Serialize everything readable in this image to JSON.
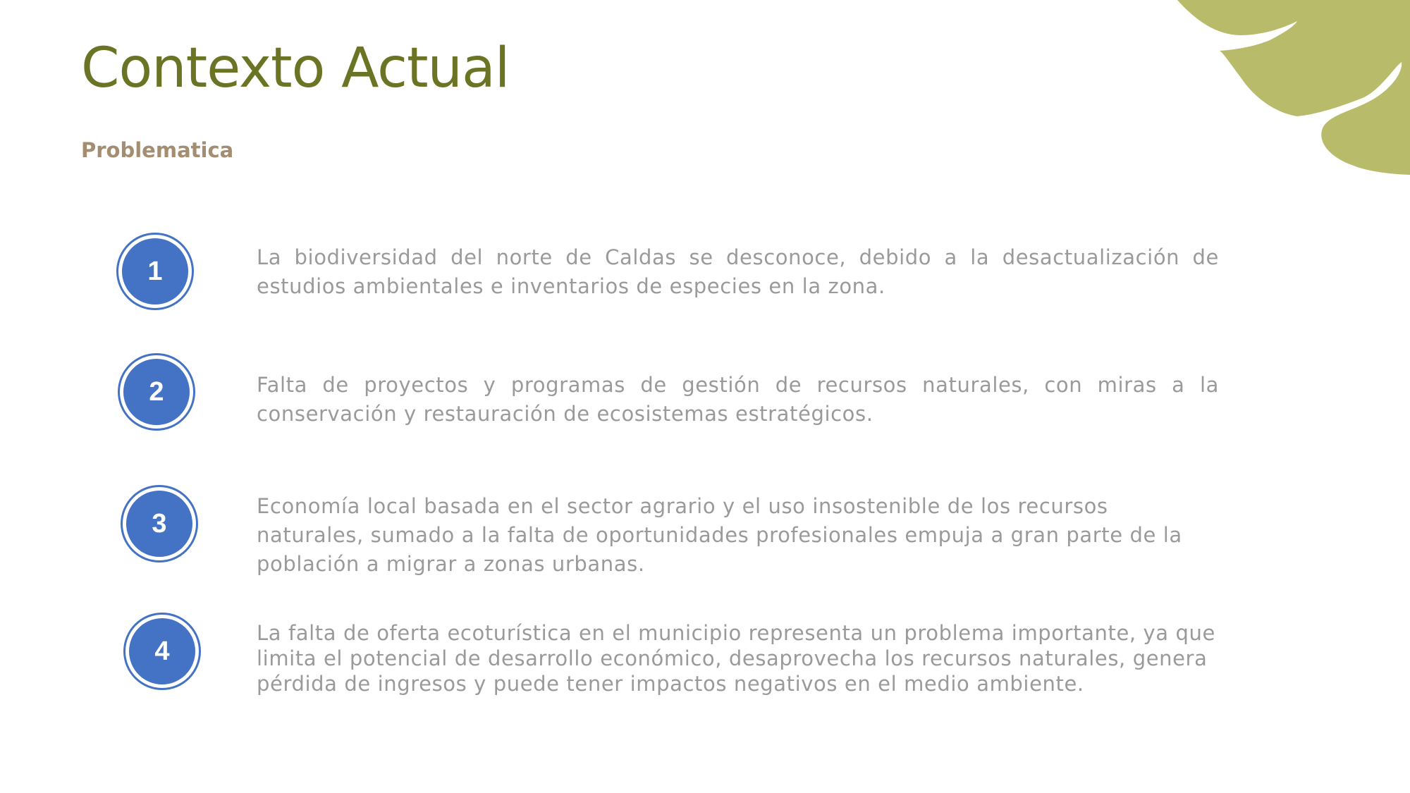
{
  "slide": {
    "title": "Contexto Actual",
    "subtitle": "Problematica",
    "accent_color": "#6b7424",
    "subtitle_color": "#a48d70",
    "leaf_color": "#b8bc6a",
    "badge_color": "#4472c4",
    "items": [
      {
        "number": "1",
        "text": "La biodiversidad del norte de Caldas se desconoce, debido a la desactualización de estudios ambientales e inventarios de especies en la zona."
      },
      {
        "number": "2",
        "text": "Falta de proyectos y programas de gestión de recursos naturales, con miras a la conservación y restauración de ecosistemas estratégicos."
      },
      {
        "number": "3",
        "text": "Economía local basada en el sector agrario y el uso insostenible de los recursos naturales, sumado a la falta de oportunidades profesionales empuja a gran parte de la población a migrar a zonas urbanas."
      },
      {
        "number": "4",
        "text": "La falta de oferta ecoturística en el municipio representa un problema importante, ya que limita el potencial de desarrollo económico, desaprovecha los recursos naturales, genera pérdida de ingresos y puede tener impactos negativos en el medio ambiente."
      }
    ]
  }
}
